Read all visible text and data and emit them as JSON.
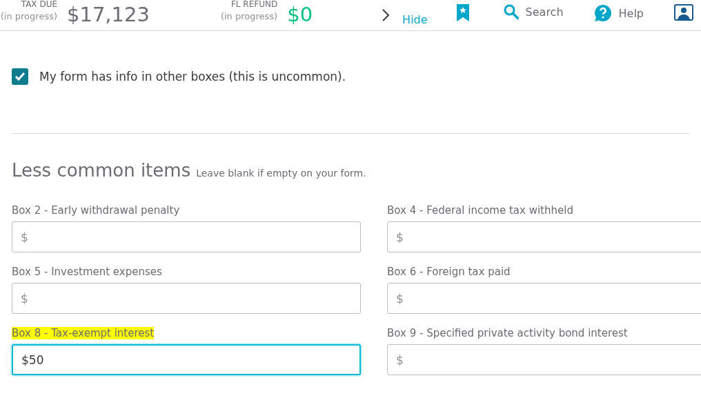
{
  "header": {
    "tax_due": {
      "label": "TAX DUE",
      "note": "(in progress)",
      "amount": "$17,123"
    },
    "refund": {
      "label": "FL REFUND",
      "note": "(in progress)",
      "amount": "$0"
    },
    "hide_link": "Hide",
    "search": "Search",
    "help": "Help"
  },
  "other_boxes": {
    "checked": true,
    "label": "My form has info in other boxes (this is uncommon)."
  },
  "section": {
    "title": "Less common items",
    "hint": "Leave blank if empty on your form."
  },
  "fields": [
    {
      "label": "Box 2 - Early withdrawal penalty",
      "placeholder": "$",
      "highlighted": false,
      "focused": false
    },
    {
      "label": "Box 4 - Federal income tax withheld",
      "placeholder": "$",
      "highlighted": false,
      "focused": false
    },
    {
      "label": "Box 5 - Investment expenses",
      "placeholder": "$",
      "highlighted": false,
      "focused": false
    },
    {
      "label": "Box 6 - Foreign tax paid",
      "placeholder": "$",
      "highlighted": false,
      "focused": false
    },
    {
      "label": "Box 8 - Tax-exempt interest",
      "value": "$50",
      "highlighted": true,
      "focused": true
    },
    {
      "label": "Box 9 - Specified private activity bond interest",
      "placeholder": "$",
      "highlighted": false,
      "focused": false
    }
  ]
}
